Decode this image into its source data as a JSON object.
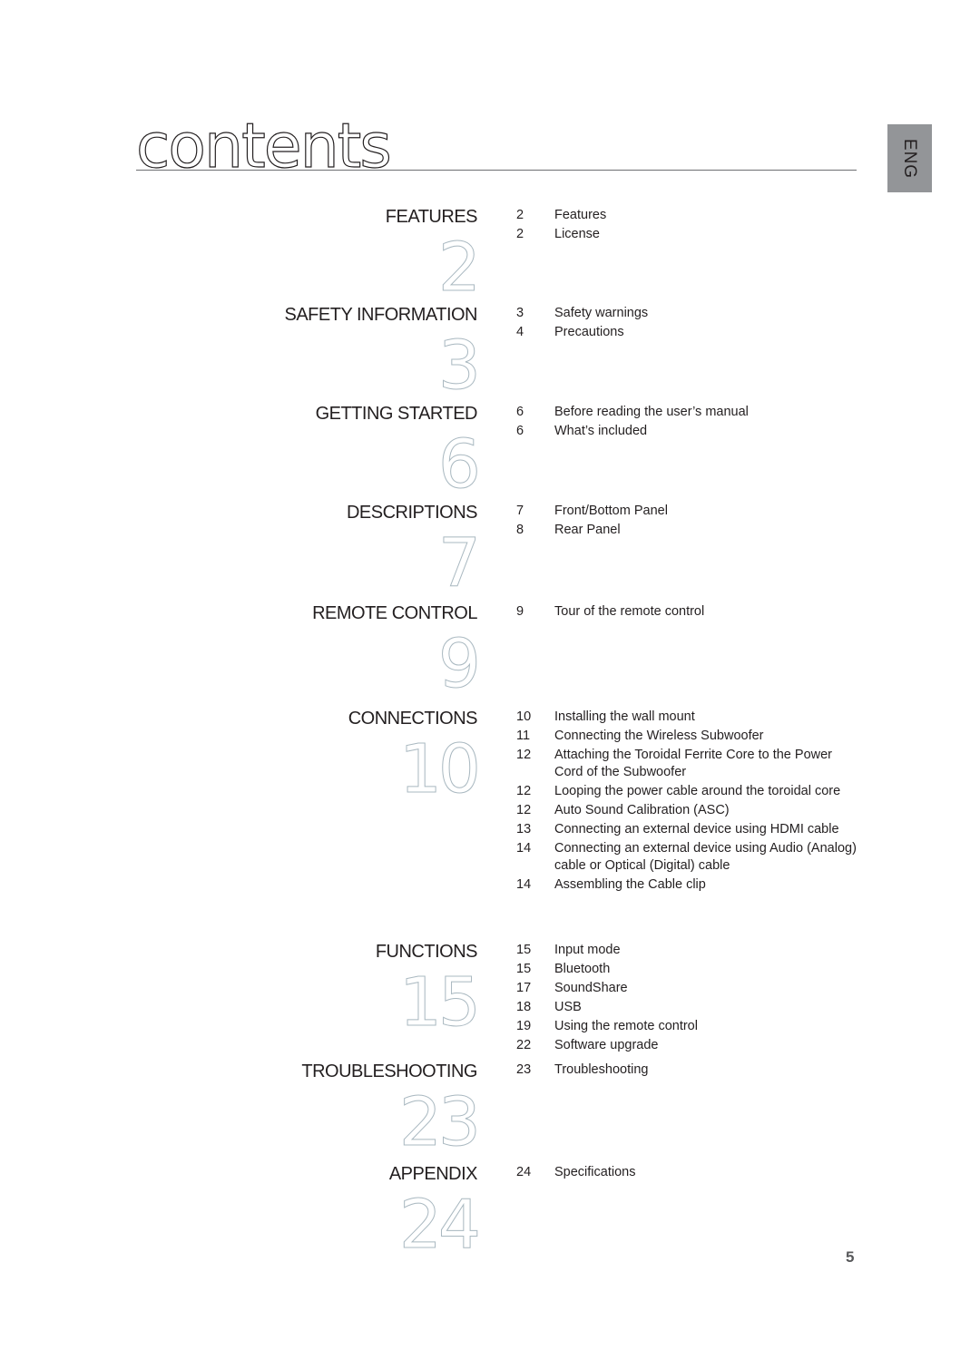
{
  "header": {
    "title": "contents",
    "language_tab": "ENG"
  },
  "sections": [
    {
      "heading": "FEATURES",
      "chapter_page": "2",
      "entries": [
        {
          "page": "2",
          "label": "Features"
        },
        {
          "page": "2",
          "label": "License"
        }
      ]
    },
    {
      "heading": "SAFETY INFORMATION",
      "chapter_page": "3",
      "entries": [
        {
          "page": "3",
          "label": "Safety warnings"
        },
        {
          "page": "4",
          "label": "Precautions"
        }
      ]
    },
    {
      "heading": "GETTING STARTED",
      "chapter_page": "6",
      "entries": [
        {
          "page": "6",
          "label": "Before reading the user’s manual"
        },
        {
          "page": "6",
          "label": "What’s included"
        }
      ]
    },
    {
      "heading": "DESCRIPTIONS",
      "chapter_page": "7",
      "entries": [
        {
          "page": "7",
          "label": "Front/Bottom Panel"
        },
        {
          "page": "8",
          "label": "Rear Panel"
        }
      ]
    },
    {
      "heading": "REMOTE CONTROL",
      "chapter_page": "9",
      "entries": [
        {
          "page": "9",
          "label": "Tour of the remote control"
        }
      ]
    },
    {
      "heading": "CONNECTIONS",
      "chapter_page": "10",
      "entries": [
        {
          "page": "10",
          "label": "Installing the wall mount"
        },
        {
          "page": "11",
          "label": "Connecting the Wireless Subwoofer"
        },
        {
          "page": "12",
          "label": "Attaching the Toroidal Ferrite Core to the Power Cord of the Subwoofer"
        },
        {
          "page": "12",
          "label": "Looping the power cable around the toroidal core"
        },
        {
          "page": "12",
          "label": "Auto Sound Calibration (ASC)"
        },
        {
          "page": "13",
          "label": "Connecting an external device using HDMI cable"
        },
        {
          "page": "14",
          "label": "Connecting an external device using Audio (Analog) cable or Optical (Digital) cable"
        },
        {
          "page": "14",
          "label": "Assembling the Cable clip"
        }
      ]
    },
    {
      "heading": "FUNCTIONS",
      "chapter_page": "15",
      "entries": [
        {
          "page": "15",
          "label": "Input mode"
        },
        {
          "page": "15",
          "label": "Bluetooth"
        },
        {
          "page": "17",
          "label": "SoundShare"
        },
        {
          "page": "18",
          "label": "USB"
        },
        {
          "page": "19",
          "label": "Using the remote control"
        },
        {
          "page": "22",
          "label": "Software upgrade"
        }
      ]
    },
    {
      "heading": "TROUBLESHOOTING",
      "chapter_page": "23",
      "entries": [
        {
          "page": "23",
          "label": "Troubleshooting"
        }
      ]
    },
    {
      "heading": "APPENDIX",
      "chapter_page": "24",
      "entries": [
        {
          "page": "24",
          "label": "Specifications"
        }
      ]
    }
  ],
  "footer": {
    "page_number": "5"
  }
}
